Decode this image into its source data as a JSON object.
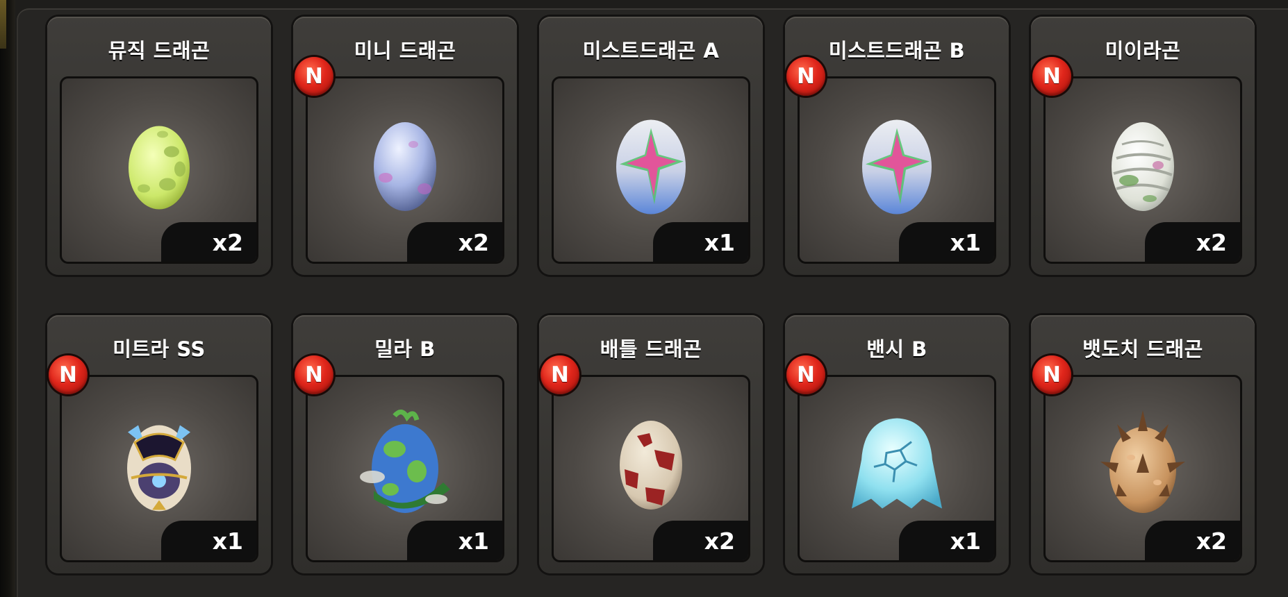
{
  "cards": [
    {
      "name": "뮤직 드래곤",
      "count": "x2",
      "new": false,
      "egg": "music",
      "badge": ""
    },
    {
      "name": "미니 드래곤",
      "count": "x2",
      "new": true,
      "egg": "mini",
      "badge": "N"
    },
    {
      "name": "미스트드래곤 A",
      "count": "x1",
      "new": false,
      "egg": "mist",
      "badge": ""
    },
    {
      "name": "미스트드래곤 B",
      "count": "x1",
      "new": true,
      "egg": "mist",
      "badge": "N"
    },
    {
      "name": "미이라곤",
      "count": "x2",
      "new": true,
      "egg": "mummy",
      "badge": "N"
    },
    {
      "name": "미트라 SS",
      "count": "x1",
      "new": true,
      "egg": "mitra",
      "badge": "N"
    },
    {
      "name": "밀라 B",
      "count": "x1",
      "new": true,
      "egg": "mila",
      "badge": "N"
    },
    {
      "name": "배틀 드래곤",
      "count": "x2",
      "new": true,
      "egg": "battle",
      "badge": "N"
    },
    {
      "name": "밴시 B",
      "count": "x1",
      "new": true,
      "egg": "banshee",
      "badge": "N"
    },
    {
      "name": "뱃도치 드래곤",
      "count": "x2",
      "new": true,
      "egg": "hedgehog",
      "badge": "N"
    }
  ],
  "colors": {
    "badge_red": "#e0261b",
    "count_bg": "#0f0f0f",
    "card_bg": "#3a3835",
    "panel_bg": "#262523"
  },
  "icons": {
    "badge": "new-badge-icon",
    "egg": "dragon-egg-icon"
  }
}
